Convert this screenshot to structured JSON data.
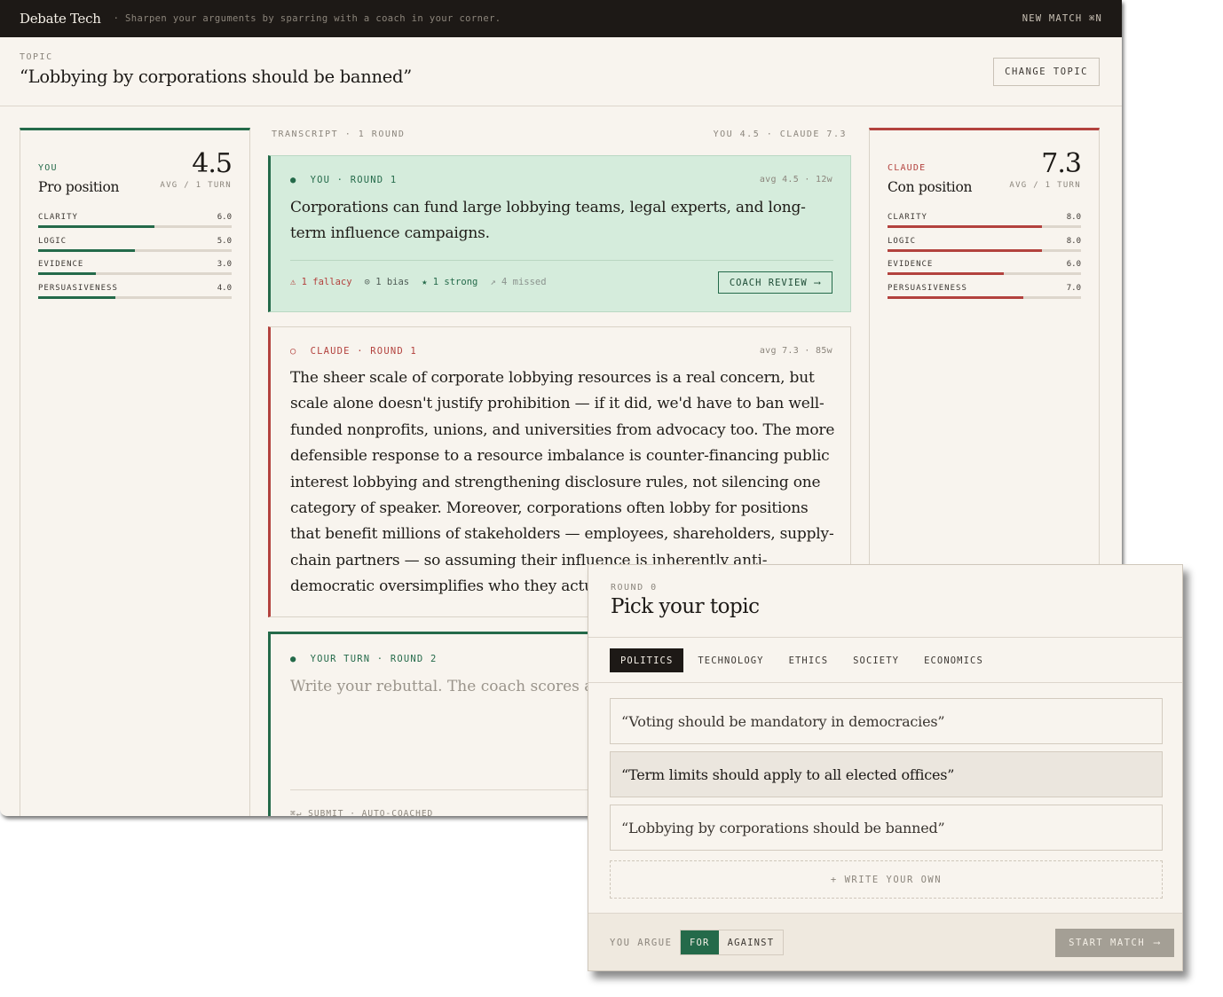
{
  "app": {
    "brand": "Debate Tech",
    "tagline": "· Sharpen your arguments by sparring with a coach in your corner.",
    "new_match": "NEW MATCH ⌘N"
  },
  "topic": {
    "label": "TOPIC",
    "title": "“Lobbying by corporations should be banned”",
    "change_button": "CHANGE TOPIC"
  },
  "you_panel": {
    "role": "YOU",
    "position": "Pro position",
    "score": "4.5",
    "avg_label": "AVG / 1 TURN",
    "accent": "#246a4a",
    "metrics": [
      {
        "name": "CLARITY",
        "value": "6.0",
        "score": 6.0
      },
      {
        "name": "LOGIC",
        "value": "5.0",
        "score": 5.0
      },
      {
        "name": "EVIDENCE",
        "value": "3.0",
        "score": 3.0
      },
      {
        "name": "PERSUASIVENESS",
        "value": "4.0",
        "score": 4.0
      }
    ]
  },
  "claude_panel": {
    "role": "CLAUDE",
    "position": "Con position",
    "score": "7.3",
    "avg_label": "AVG / 1 TURN",
    "accent": "#b3423e",
    "metrics": [
      {
        "name": "CLARITY",
        "value": "8.0",
        "score": 8.0
      },
      {
        "name": "LOGIC",
        "value": "8.0",
        "score": 8.0
      },
      {
        "name": "EVIDENCE",
        "value": "6.0",
        "score": 6.0
      },
      {
        "name": "PERSUASIVENESS",
        "value": "7.0",
        "score": 7.0
      }
    ]
  },
  "transcript": {
    "header": "TRANSCRIPT · 1 ROUND",
    "score_summary": "YOU 4.5 · CLAUDE 7.3",
    "you_turn": {
      "marker": "●",
      "label": "YOU · ROUND 1",
      "meta": "avg 4.5 · 12w",
      "text": "Corporations can fund large lobbying teams, legal experts, and long-term influence campaigns.",
      "fallacy": "⚠ 1 fallacy",
      "bias": "⊙ 1 bias",
      "strong": "★ 1 strong",
      "missed": "↗ 4 missed",
      "coach_button": "COACH REVIEW",
      "coach_arrow": "⟶"
    },
    "claude_turn": {
      "marker": "○",
      "label": "CLAUDE · ROUND 1",
      "meta": "avg 7.3 · 85w",
      "text": "The sheer scale of corporate lobbying resources is a real concern, but scale alone doesn't justify prohibition — if it did, we'd have to ban well-funded nonprofits, unions, and universities from advocacy too. The more defensible response to a resource imbalance is counter-financing public interest lobbying and strengthening disclosure rules, not silencing one category of speaker. Moreover, corporations often lobby for positions that benefit millions of stakeholders — employees, shareholders, supply-chain partners — so assuming their influence is inherently anti-democratic oversimplifies who they actually represent."
    },
    "rebuttal": {
      "marker": "●",
      "label": "YOUR TURN · ROUND 2",
      "placeholder": "Write your rebuttal. The coach scores after you submit.",
      "hint": "⌘↵ SUBMIT · AUTO-COACHED"
    }
  },
  "picker": {
    "round": "ROUND 0",
    "title": "Pick your topic",
    "tabs": [
      "POLITICS",
      "TECHNOLOGY",
      "ETHICS",
      "SOCIETY",
      "ECONOMICS"
    ],
    "active_tab": "POLITICS",
    "options": [
      "“Voting should be mandatory in democracies”",
      "“Term limits should apply to all elected offices”",
      "“Lobbying by corporations should be banned”"
    ],
    "write_own": "+ WRITE YOUR OWN",
    "argue_label": "YOU ARGUE",
    "side_for": "FOR",
    "side_against": "AGAINST",
    "selected_side": "FOR",
    "start_button": "START MATCH",
    "start_arrow": "⟶"
  }
}
